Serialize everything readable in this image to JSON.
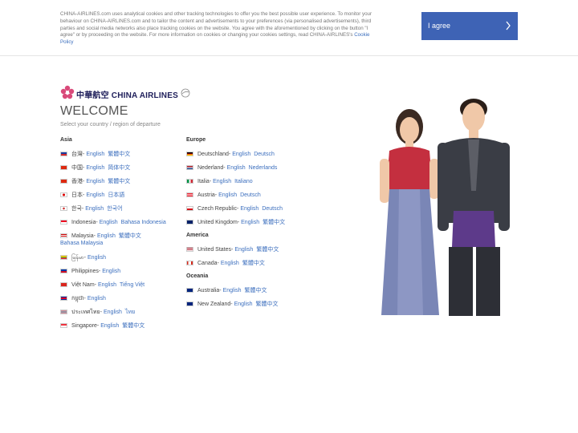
{
  "cookie": {
    "text": "CHINA-AIRLINES.com uses analytical cookies and other tracking technologies to offer you the best possible user experience. To monitor your behaviour on CHINA-AIRLINES.com and to tailor the content and advertisements to your preferences (via personalised advertisements), third parties and social media networks also place tracking cookies on the website. You agree with the aforementioned by clicking on the button \"I agree\" or by proceeding on the website. For more information on cookies or changing your cookies settings, read CHINA-AIRLINES's ",
    "policy_link": "Cookie Policy",
    "agree_label": "I agree",
    "agree_icon": "chevron-right-icon",
    "agree_color": "#3e63b5"
  },
  "brand": {
    "logo_icon": "plum-blossom-logo",
    "chinese": "中華航空",
    "name": "CHINA AIRLINES"
  },
  "welcome": "WELCOME",
  "subtitle": "Select your country / region of departure",
  "link_color": "#3c6fbe",
  "regions": [
    {
      "name": "Asia",
      "countries": [
        {
          "name": "台灣-",
          "flag": "taiwan-flag",
          "links": [
            "English",
            "繁體中文"
          ]
        },
        {
          "name": "中国-",
          "flag": "china-flag",
          "links": [
            "English",
            "简体中文"
          ]
        },
        {
          "name": "香港-",
          "flag": "hongkong-flag",
          "links": [
            "English",
            "繁體中文"
          ]
        },
        {
          "name": "日本-",
          "flag": "japan-flag",
          "links": [
            "English",
            "日本語"
          ]
        },
        {
          "name": "한국-",
          "flag": "korea-flag",
          "links": [
            "English",
            "한국어"
          ]
        },
        {
          "name": "Indonesia-",
          "flag": "indonesia-flag",
          "links": [
            "English",
            "Bahasa Indonesia"
          ]
        },
        {
          "name": "Malaysia-",
          "flag": "malaysia-flag",
          "links": [
            "English",
            "繁體中文",
            "Bahasa Malaysia"
          ]
        },
        {
          "name": "မြန်မာ-",
          "flag": "myanmar-flag",
          "links": [
            "English"
          ]
        },
        {
          "name": "Philippines-",
          "flag": "philippines-flag",
          "links": [
            "English"
          ]
        },
        {
          "name": "Việt Nam-",
          "flag": "vietnam-flag",
          "links": [
            "English",
            "Tiếng Việt"
          ]
        },
        {
          "name": "កម្ពុជា-",
          "flag": "cambodia-flag",
          "links": [
            "English"
          ]
        },
        {
          "name": "ประเทศไทย-",
          "flag": "thailand-flag",
          "links": [
            "English",
            "ไทย"
          ]
        },
        {
          "name": "Singapore-",
          "flag": "singapore-flag",
          "links": [
            "English",
            "繁體中文"
          ]
        }
      ]
    },
    {
      "name": "Europe",
      "countries": [
        {
          "name": "Deutschland-",
          "flag": "germany-flag",
          "links": [
            "English",
            "Deutsch"
          ]
        },
        {
          "name": "Nederland-",
          "flag": "netherlands-flag",
          "links": [
            "English",
            "Nederlands"
          ]
        },
        {
          "name": "Italia-",
          "flag": "italy-flag",
          "links": [
            "English",
            "Italiano"
          ]
        },
        {
          "name": "Austria-",
          "flag": "austria-flag",
          "links": [
            "English",
            "Deutsch"
          ]
        },
        {
          "name": "Czech Republic-",
          "flag": "czech-flag",
          "links": [
            "English",
            "Deutsch"
          ]
        },
        {
          "name": "United Kingdom-",
          "flag": "uk-flag",
          "links": [
            "English",
            "繁體中文"
          ]
        }
      ]
    },
    {
      "name": "America",
      "countries": [
        {
          "name": "United States-",
          "flag": "usa-flag",
          "links": [
            "English",
            "繁體中文"
          ]
        },
        {
          "name": "Canada-",
          "flag": "canada-flag",
          "links": [
            "English",
            "繁體中文"
          ]
        }
      ]
    },
    {
      "name": "Oceania",
      "countries": [
        {
          "name": "Australia-",
          "flag": "australia-flag",
          "links": [
            "English",
            "繁體中文"
          ]
        },
        {
          "name": "New Zealand-",
          "flag": "newzealand-flag",
          "links": [
            "English",
            "繁體中文"
          ]
        }
      ]
    }
  ],
  "hero_image": "flight-attendants-photo"
}
